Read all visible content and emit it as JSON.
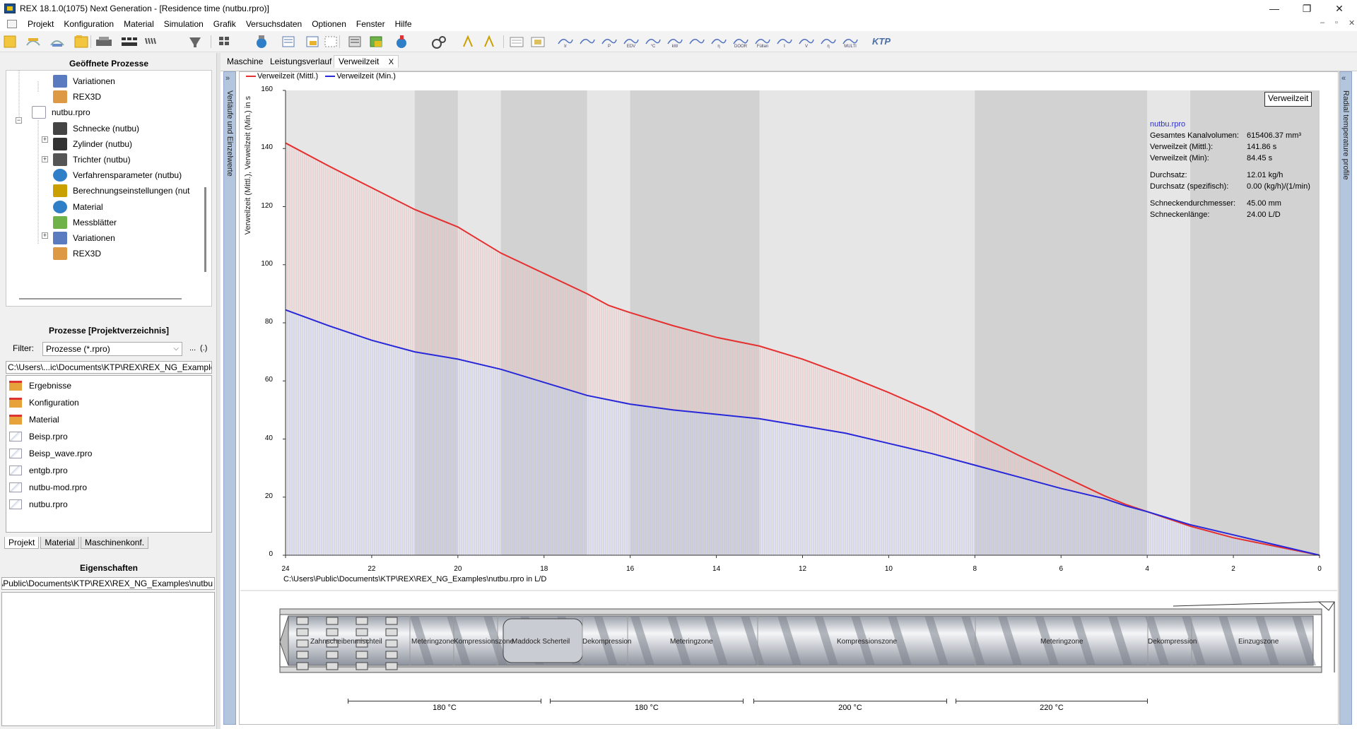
{
  "window": {
    "title": "REX 18.1.0(1075) Next Generation - [Residence time (nutbu.rpro)]",
    "controls": {
      "minimize": "—",
      "maximize": "❐",
      "close": "✕"
    }
  },
  "menu": {
    "items": [
      "Projekt",
      "Konfiguration",
      "Material",
      "Simulation",
      "Grafik",
      "Versuchsdaten",
      "Optionen",
      "Fenster",
      "Hilfe"
    ],
    "mdi_controls": [
      "–",
      "▫",
      "✕"
    ]
  },
  "toolbar": {
    "ktp_label": "KTP",
    "icons": [
      "new-project-icon",
      "open-icon",
      "configure-icon",
      "folder-icon",
      "print-icon",
      "screw-icon",
      "screw-elements-icon",
      "hopper-icon",
      "cylinder-icon",
      "material-icon",
      "table-icon",
      "import-icon",
      "grid-icon",
      "measurement-icon",
      "calculation-icon",
      "process-icon",
      "settings-icon",
      "compute-icon",
      "compute-all-icon",
      "report-icon",
      "report2-icon",
      "chart-icons"
    ],
    "chart_buttons": [
      "Ir",
      "",
      "P",
      "EDV",
      "°C",
      "kW",
      "",
      "η",
      "DOOR",
      "Füllan",
      "t",
      "V",
      "η",
      "MULTI"
    ]
  },
  "left_panel": {
    "open_processes_header": "Geöffnete Prozesse",
    "tree": [
      {
        "label": "Variationen",
        "icon": "variations-icon",
        "level": 2
      },
      {
        "label": "REX3D",
        "icon": "rex3d-icon",
        "level": 2
      },
      {
        "label": "nutbu.rpro",
        "icon": "project-icon",
        "level": 1
      },
      {
        "label": "Schnecke (nutbu)",
        "icon": "screw-icon",
        "level": 2
      },
      {
        "label": "Zylinder (nutbu)",
        "icon": "cylinder-icon",
        "level": 2
      },
      {
        "label": "Trichter (nutbu)",
        "icon": "hopper-icon",
        "level": 2
      },
      {
        "label": "Verfahrensparameter (nutbu)",
        "icon": "process-params-icon",
        "level": 2
      },
      {
        "label": "Berechnungseinstellungen (nut",
        "icon": "calc-settings-icon",
        "level": 2
      },
      {
        "label": "Material",
        "icon": "material-icon",
        "level": 2
      },
      {
        "label": "Messblätter",
        "icon": "measurement-sheets-icon",
        "level": 2
      },
      {
        "label": "Variationen",
        "icon": "variations-icon",
        "level": 2
      },
      {
        "label": "REX3D",
        "icon": "rex3d-icon",
        "level": 2
      }
    ],
    "processes_header": "Prozesse [Projektverzeichnis]",
    "filter_label": "Filter:",
    "filter_value": "Prozesse  (*.rpro)",
    "filter_buttons": [
      "...",
      "(.)"
    ],
    "path": "C:\\Users\\...ic\\Documents\\KTP\\REX\\REX_NG_Examples",
    "files": [
      {
        "label": "Ergebnisse",
        "type": "folder"
      },
      {
        "label": "Konfiguration",
        "type": "folder"
      },
      {
        "label": "Material",
        "type": "folder"
      },
      {
        "label": "Beisp.rpro",
        "type": "project"
      },
      {
        "label": "Beisp_wave.rpro",
        "type": "project"
      },
      {
        "label": "entgb.rpro",
        "type": "project"
      },
      {
        "label": "nutbu-mod.rpro",
        "type": "project"
      },
      {
        "label": "nutbu.rpro",
        "type": "project"
      }
    ],
    "bottom_tabs": [
      "Projekt",
      "Material",
      "Maschinenkonf."
    ],
    "properties_header": "Eigenschaften",
    "properties_path": "C:\\Users\\Public\\Documents\\KTP\\REX\\REX_NG_Examples\\nutbu"
  },
  "main": {
    "tabs": [
      "Maschine",
      "Leistungsverlauf",
      "Verweilzeit"
    ],
    "tab_close": "X",
    "left_strip_label": "Verläufe und Einzelwerte",
    "right_strip_label": "Radial temperature profile",
    "verweilzeit_button": "Verweilzeit",
    "info": {
      "title": "nutbu.rpro",
      "rows": [
        {
          "label": "Gesamtes Kanalvolumen:",
          "value": "615406.37 mm³"
        },
        {
          "label": "Verweilzeit (Mittl.):",
          "value": "141.86 s"
        },
        {
          "label": "Verweilzeit (Min):",
          "value": "84.45 s"
        },
        {
          "label": "",
          "value": ""
        },
        {
          "label": "Durchsatz:",
          "value": "12.01 kg/h"
        },
        {
          "label": "Durchsatz (spezifisch):",
          "value": "0.00 (kg/h)/(1/min)"
        },
        {
          "label": "",
          "value": ""
        },
        {
          "label": "Schneckendurchmesser:",
          "value": "45.00 mm"
        },
        {
          "label": "Schneckenlänge:",
          "value": "24.00 L/D"
        }
      ]
    },
    "x_caption": "C:\\Users\\Public\\Documents\\KTP\\REX\\REX_NG_Examples\\nutbu.rpro in L/D",
    "screw_zones": [
      {
        "label": "Zahnscheibenmischteil"
      },
      {
        "label": "Meteringzone"
      },
      {
        "label": "Kompressionszone"
      },
      {
        "label": "Maddock Scherteil"
      },
      {
        "label": "Dekompression"
      },
      {
        "label": "Meteringzone"
      },
      {
        "label": "Kompressionszone"
      },
      {
        "label": "Meteringzone"
      },
      {
        "label": "Dekompression"
      },
      {
        "label": "Einzugszone"
      }
    ],
    "temperatures": [
      "180 °C",
      "180 °C",
      "200 °C",
      "220 °C"
    ]
  },
  "chart_data": {
    "type": "line",
    "title": "",
    "xlabel": "",
    "ylabel": "Verweilzeit (Mittl.), Verweilzeit (Min.) in s",
    "xlim": [
      24,
      0
    ],
    "ylim": [
      0,
      160
    ],
    "x_ticks": [
      24,
      22,
      20,
      18,
      16,
      14,
      12,
      10,
      8,
      6,
      4,
      2,
      0
    ],
    "y_ticks": [
      0,
      20,
      40,
      60,
      80,
      100,
      120,
      140,
      160
    ],
    "legend_position": "top-left",
    "series": [
      {
        "name": "Verweilzeit (Mittl.)",
        "color": "#e53030",
        "x": [
          24,
          23,
          22,
          21,
          20,
          19.5,
          19,
          18,
          17,
          16.5,
          16,
          15,
          14,
          13,
          12,
          11,
          10,
          9,
          8,
          7,
          6,
          5,
          4.5,
          4,
          3,
          2,
          1,
          0
        ],
        "y": [
          141.9,
          134,
          126.5,
          119,
          113,
          108.5,
          104,
          97,
          90,
          86,
          83.5,
          79,
          75,
          72,
          67.5,
          62,
          56,
          49.5,
          42,
          34.5,
          27.5,
          20.5,
          17.5,
          15,
          10,
          6,
          3,
          0
        ]
      },
      {
        "name": "Verweilzeit (Min.)",
        "color": "#2828d8",
        "x": [
          24,
          23,
          22,
          21,
          20,
          19,
          18,
          17,
          16,
          15,
          14,
          13,
          12,
          11,
          10,
          9,
          8,
          7,
          6,
          5,
          4.5,
          4,
          3,
          2,
          1,
          0
        ],
        "y": [
          84.45,
          79,
          74,
          70,
          67.5,
          64,
          59.5,
          55,
          52,
          50,
          48.5,
          47,
          44.5,
          42,
          38.5,
          35,
          31,
          27,
          23,
          19.5,
          17,
          15,
          10.5,
          7,
          3.5,
          0
        ]
      }
    ],
    "zone_bands_ld": [
      [
        24,
        21
      ],
      [
        21,
        20
      ],
      [
        20,
        19
      ],
      [
        19,
        17
      ],
      [
        17,
        16
      ],
      [
        16,
        13
      ],
      [
        13,
        8
      ],
      [
        8,
        4
      ],
      [
        4,
        3
      ],
      [
        3,
        0
      ]
    ]
  }
}
